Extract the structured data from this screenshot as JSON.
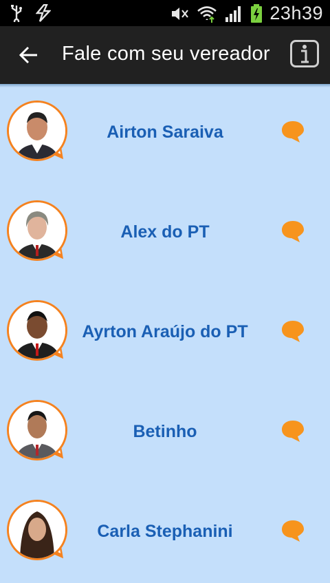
{
  "status_bar": {
    "time": "23h39",
    "left_icons": [
      "usb-icon",
      "flash-icon"
    ],
    "right_icons": [
      "mute-icon",
      "wifi-icon",
      "signal-icon",
      "battery-icon"
    ]
  },
  "app_bar": {
    "title": "Fale com seu vereador",
    "back_icon": "arrow-left-icon",
    "info_icon": "info-icon"
  },
  "colors": {
    "accent": "#f5821f",
    "name_text": "#1a5fb4",
    "list_background": "#c4dffb",
    "app_bar": "#212121"
  },
  "councilors": [
    {
      "name": "Airton Saraiva"
    },
    {
      "name": "Alex do PT"
    },
    {
      "name": "Ayrton Araújo do PT"
    },
    {
      "name": "Betinho"
    },
    {
      "name": "Carla Stephanini"
    }
  ]
}
